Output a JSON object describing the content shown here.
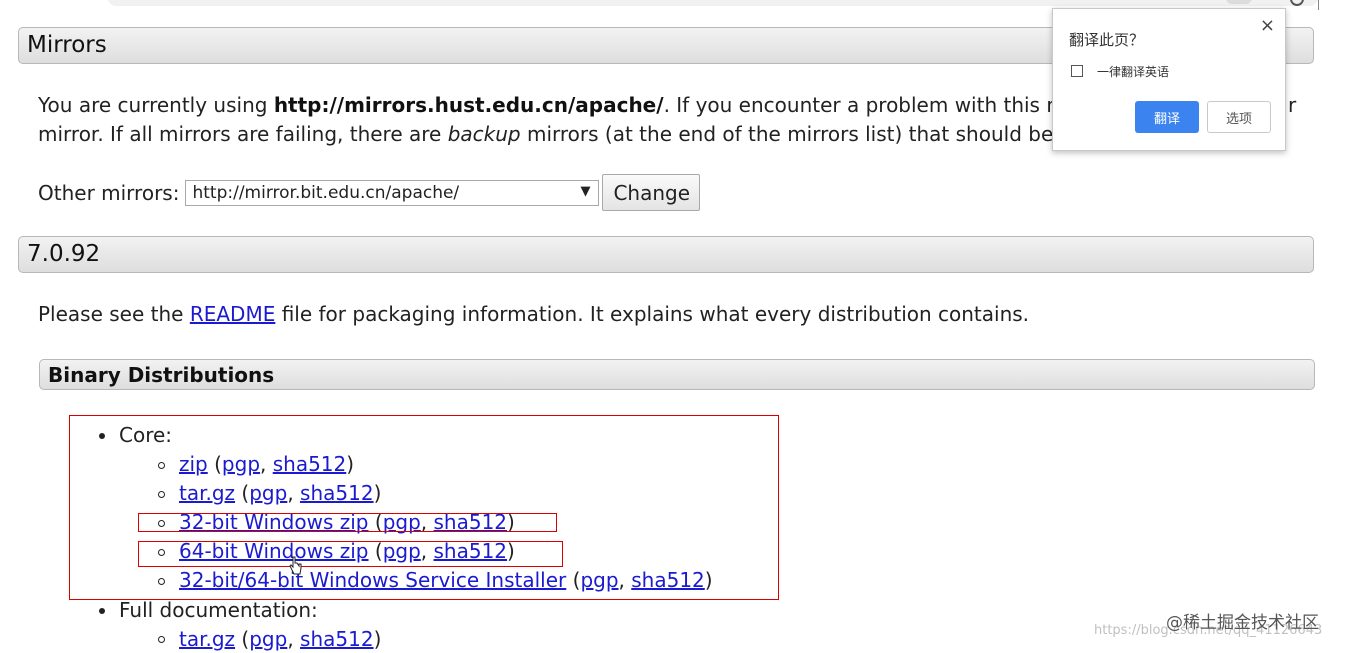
{
  "mirrors_section": {
    "heading": "Mirrors",
    "intro_prefix": "You are currently using ",
    "current_mirror": "http://mirrors.hust.edu.cn/apache/",
    "intro_middle": ". If you encounter a problem with this mirr",
    "intro_tail_r": "r",
    "line2_prefix": "mirror. If all mirrors are failing, there are ",
    "backup_word": "backup",
    "line2_suffix": " mirrors (at the end of the mirrors list) that should be av",
    "other_label": "Other mirrors:",
    "selected_mirror": "http://mirror.bit.edu.cn/apache/",
    "change_button": "Change"
  },
  "version_section": {
    "heading": "7.0.92",
    "readme_prefix": "Please see the ",
    "readme_link": "README",
    "readme_suffix": " file for packaging information. It explains what every distribution contains."
  },
  "binary_section": {
    "heading": "Binary Distributions",
    "core_label": "Core:",
    "core_items": [
      {
        "main": "zip",
        "pgp": "pgp",
        "sha": "sha512"
      },
      {
        "main": "tar.gz",
        "pgp": "pgp",
        "sha": "sha512"
      },
      {
        "main": "32-bit Windows zip",
        "pgp": "pgp",
        "sha": "sha512"
      },
      {
        "main": "64-bit Windows zip",
        "pgp": "pgp",
        "sha": "sha512"
      },
      {
        "main": "32-bit/64-bit Windows Service Installer",
        "pgp": "pgp",
        "sha": "sha512"
      }
    ],
    "docs_label": "Full documentation:",
    "docs_items": [
      {
        "main": "tar.gz",
        "pgp": "pgp",
        "sha": "sha512"
      }
    ]
  },
  "translate_popup": {
    "title": "翻译此页？",
    "close": "×",
    "checkbox_label": "一律翻译英语",
    "translate_button": "翻译",
    "options_button": "选项"
  },
  "watermark": {
    "logo_text": "@稀土掘金技术社区",
    "url_text": "https://blog.csdn.net/qq_41126643"
  }
}
